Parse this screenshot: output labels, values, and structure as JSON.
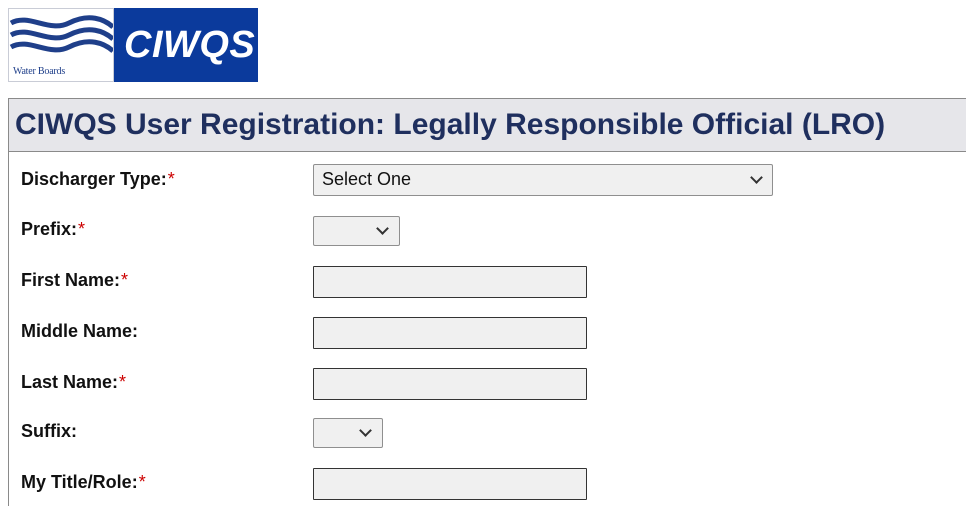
{
  "logo": {
    "org_text": "Water Boards",
    "app_text": "CIWQS",
    "colors": {
      "blue_panel": "#0b3a9c",
      "wave_blue": "#1f3f8a"
    }
  },
  "header": {
    "title": "CIWQS User Registration: Legally Responsible Official (LRO)"
  },
  "form": {
    "required_marker": "*",
    "fields": {
      "discharger_type": {
        "label": "Discharger Type:",
        "selected": "Select One"
      },
      "prefix": {
        "label": "Prefix:",
        "selected": ""
      },
      "first_name": {
        "label": "First Name:",
        "value": ""
      },
      "middle_name": {
        "label": "Middle Name:",
        "value": ""
      },
      "last_name": {
        "label": "Last Name:",
        "value": ""
      },
      "suffix": {
        "label": "Suffix:",
        "selected": ""
      },
      "title_role": {
        "label": "My Title/Role:",
        "value": ""
      }
    }
  },
  "theme": {
    "header_bg": "#e6e6ea",
    "title_color": "#1f2f5e",
    "required_color": "#cc0000",
    "input_bg": "#f0f0f0"
  }
}
